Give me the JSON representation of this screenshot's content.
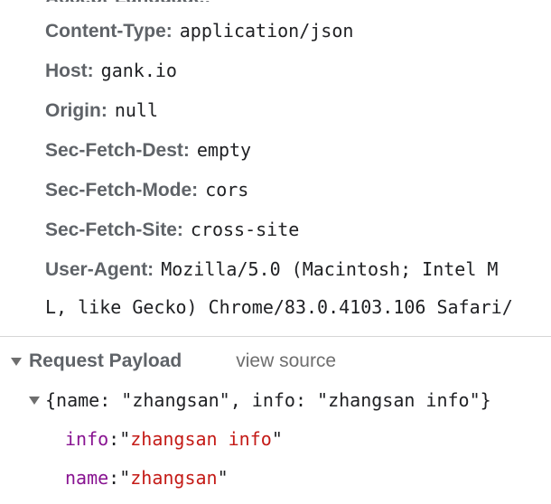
{
  "request_headers": [
    {
      "name": "Content-Type:",
      "value": "application/json"
    },
    {
      "name": "Host:",
      "value": "gank.io"
    },
    {
      "name": "Origin:",
      "value": "null"
    },
    {
      "name": "Sec-Fetch-Dest:",
      "value": "empty"
    },
    {
      "name": "Sec-Fetch-Mode:",
      "value": "cors"
    },
    {
      "name": "Sec-Fetch-Site:",
      "value": "cross-site"
    },
    {
      "name": "User-Agent:",
      "value": "Mozilla/5.0 (Macintosh; Intel M"
    }
  ],
  "user_agent_continuation": "L, like Gecko) Chrome/83.0.4103.106 Safari/",
  "request_payload": {
    "title": "Request Payload",
    "view_source_label": "view source",
    "summary": "{name: \"zhangsan\", info: \"zhangsan info\"}",
    "properties": [
      {
        "key": "info",
        "value": "zhangsan info"
      },
      {
        "key": "name",
        "value": "zhangsan"
      }
    ]
  },
  "icons": {
    "section_toggle": "triangle-down-icon",
    "object_toggle": "triangle-down-icon"
  },
  "colors": {
    "header_name": "#5f6368",
    "property_key": "#881391",
    "string_value": "#c41a16",
    "divider": "#d6d6d6"
  }
}
